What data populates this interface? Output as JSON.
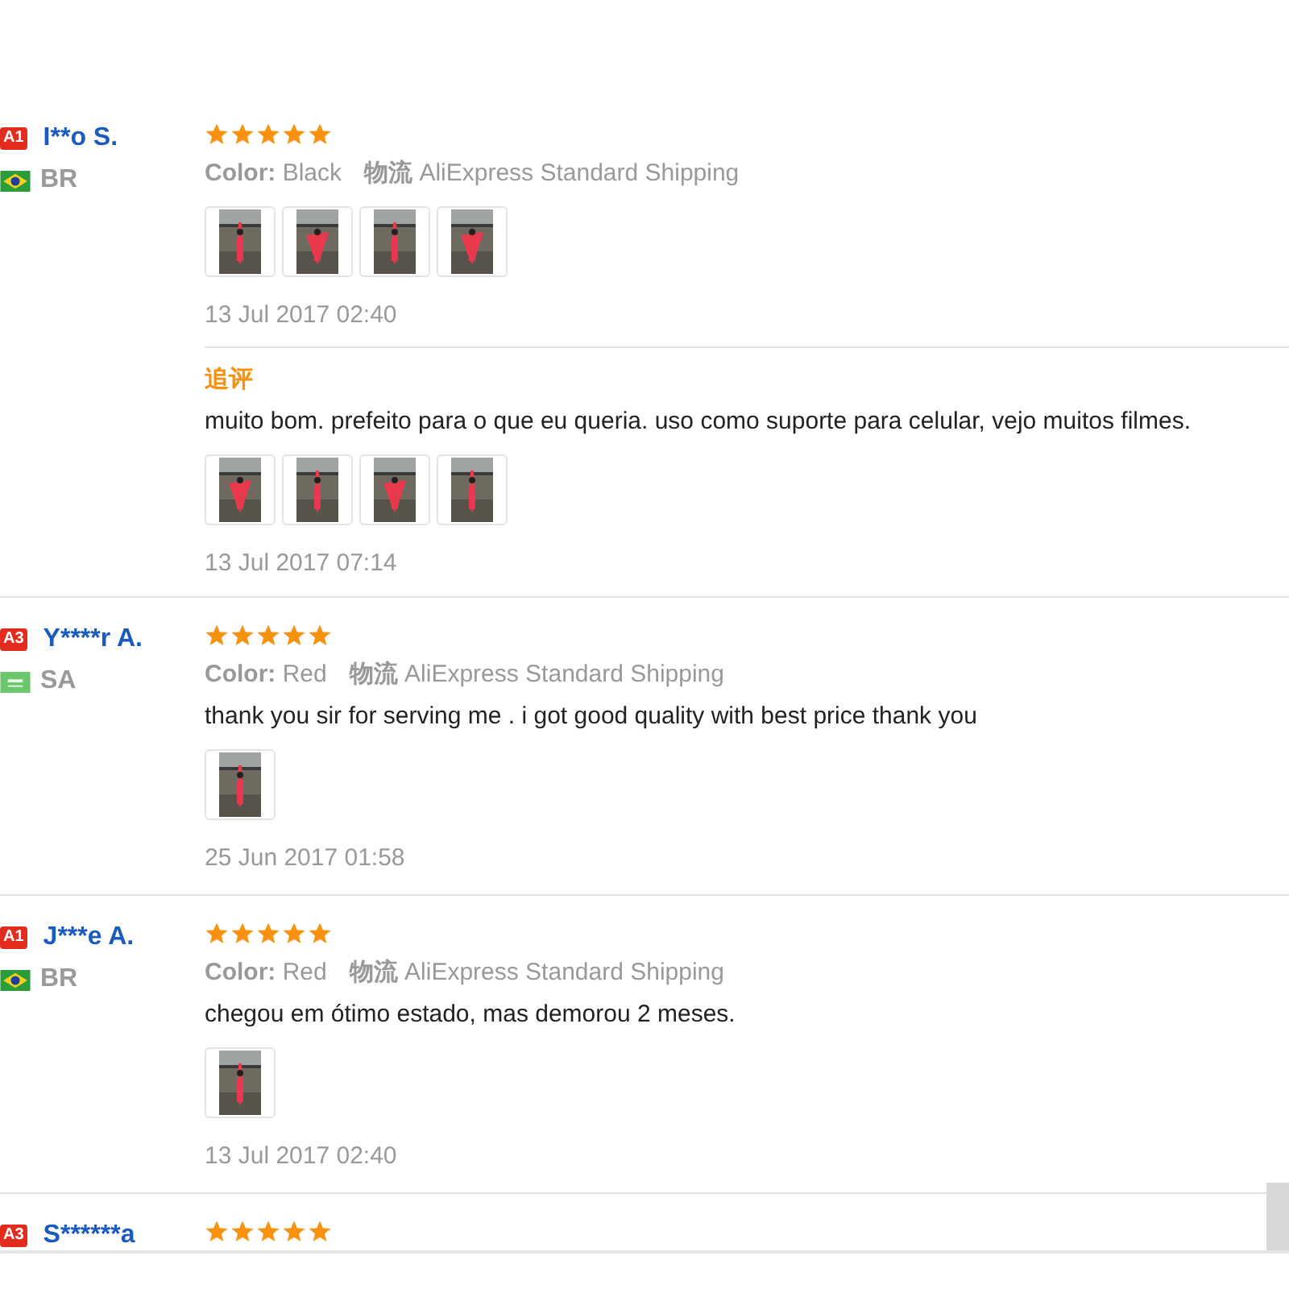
{
  "reviews": [
    {
      "badge": "A1",
      "name": "I**o S.",
      "flag": {
        "kind": "brazil"
      },
      "country": "BR",
      "stars": 5,
      "color_label": "Color:",
      "color_value": "Black",
      "shipping_label": "物流",
      "shipping": "AliExpress Standard Shipping",
      "photos": [
        {
          "kind": "picture"
        },
        {
          "kind": "picture"
        },
        {
          "kind": "picture"
        },
        {
          "kind": "picture"
        }
      ],
      "date": "13 Jul 2017 02:40",
      "followup": {
        "title": "追评",
        "comment": "muito bom. prefeito para o que eu queria. uso como suporte para celular, vejo muitos filmes.",
        "photos": [
          {
            "kind": "picture"
          },
          {
            "kind": "picture"
          },
          {
            "kind": "picture"
          },
          {
            "kind": "picture"
          }
        ],
        "date": "13 Jul 2017 07:14"
      }
    },
    {
      "badge": "A3",
      "name": "Y****r A.",
      "flag": {
        "kind": "saudi"
      },
      "country": "SA",
      "stars": 5,
      "color_label": "Color:",
      "color_value": "Red",
      "shipping_label": "物流",
      "shipping": "AliExpress Standard Shipping",
      "comment": "thank you sir for serving me . i got good quality with best price thank you",
      "photos": [
        {
          "kind": "picture"
        }
      ],
      "date": "25 Jun 2017 01:58"
    },
    {
      "badge": "A1",
      "name": "J***e A.",
      "flag": {
        "kind": "brazil"
      },
      "country": "BR",
      "stars": 5,
      "color_label": "Color:",
      "color_value": "Red",
      "shipping_label": "物流",
      "shipping": "AliExpress Standard Shipping",
      "comment": "chegou em ótimo estado, mas demorou 2 meses.",
      "photos": [
        {
          "kind": "picture"
        }
      ],
      "date": "13 Jul 2017 02:40"
    },
    {
      "badge": "A3",
      "name": "S******a",
      "stars": 5
    }
  ]
}
